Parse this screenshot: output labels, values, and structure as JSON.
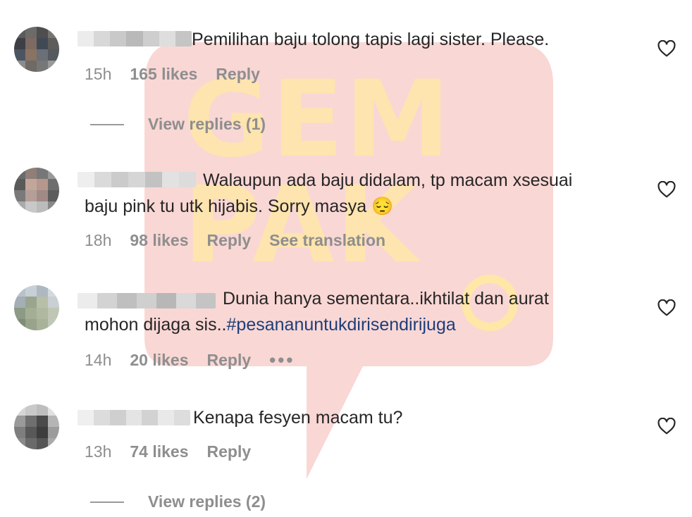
{
  "watermark": {
    "text": "GEM PAK"
  },
  "comments": [
    {
      "text_lines": [
        "Pemilihan baju tolong tapis lagi sister. Please."
      ],
      "time": "15h",
      "likes": "165 likes",
      "reply": "Reply",
      "view_replies": "View replies (1)"
    },
    {
      "text_lines": [
        "Walaupun ada baju didalam, tp macam xsesuai",
        "baju pink tu utk hijabis. Sorry masya"
      ],
      "emoji": "😔",
      "time": "18h",
      "likes": "98 likes",
      "reply": "Reply",
      "see_translation": "See translation"
    },
    {
      "text_lines": [
        "Dunia hanya sementara..ikhtilat dan aurat",
        "mohon dijaga sis.."
      ],
      "hashtag": "#pesananuntukdirisendirijuga",
      "time": "14h",
      "likes": "20 likes",
      "reply": "Reply",
      "more": "•••"
    },
    {
      "text_lines": [
        "Kenapa fesyen macam tu?"
      ],
      "time": "13h",
      "likes": "74 likes",
      "reply": "Reply",
      "view_replies": "View replies (2)"
    }
  ],
  "colors": {
    "text": "#262626",
    "meta": "#8e8e8e",
    "hashtag": "#1d3e78",
    "watermark_red": "#f7c9c7",
    "watermark_yellow": "#ffe7a8"
  },
  "icons": [
    "heart-icon",
    "more-options-icon"
  ]
}
